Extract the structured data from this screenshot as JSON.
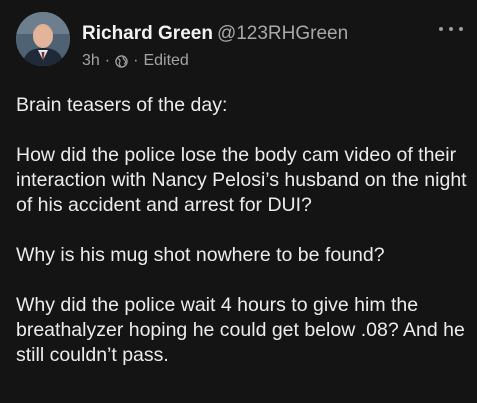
{
  "post": {
    "author": {
      "name": "Richard Green",
      "handle": "@123RHGreen"
    },
    "meta": {
      "time": "3h",
      "separator": "·",
      "edited": "Edited",
      "visibility_icon": "globe-icon"
    },
    "more_icon": "more-dots-icon",
    "paragraphs": [
      "Brain teasers of the day:",
      "How did the police lose the body cam video of their interaction with Nancy Pelosi’s husband on the night of his accident and arrest for DUI?",
      "Why is his mug shot nowhere to be found?",
      "Why did the police wait 4 hours to give him the breathalyzer hoping he could get below .08? And he still couldn’t pass."
    ]
  }
}
